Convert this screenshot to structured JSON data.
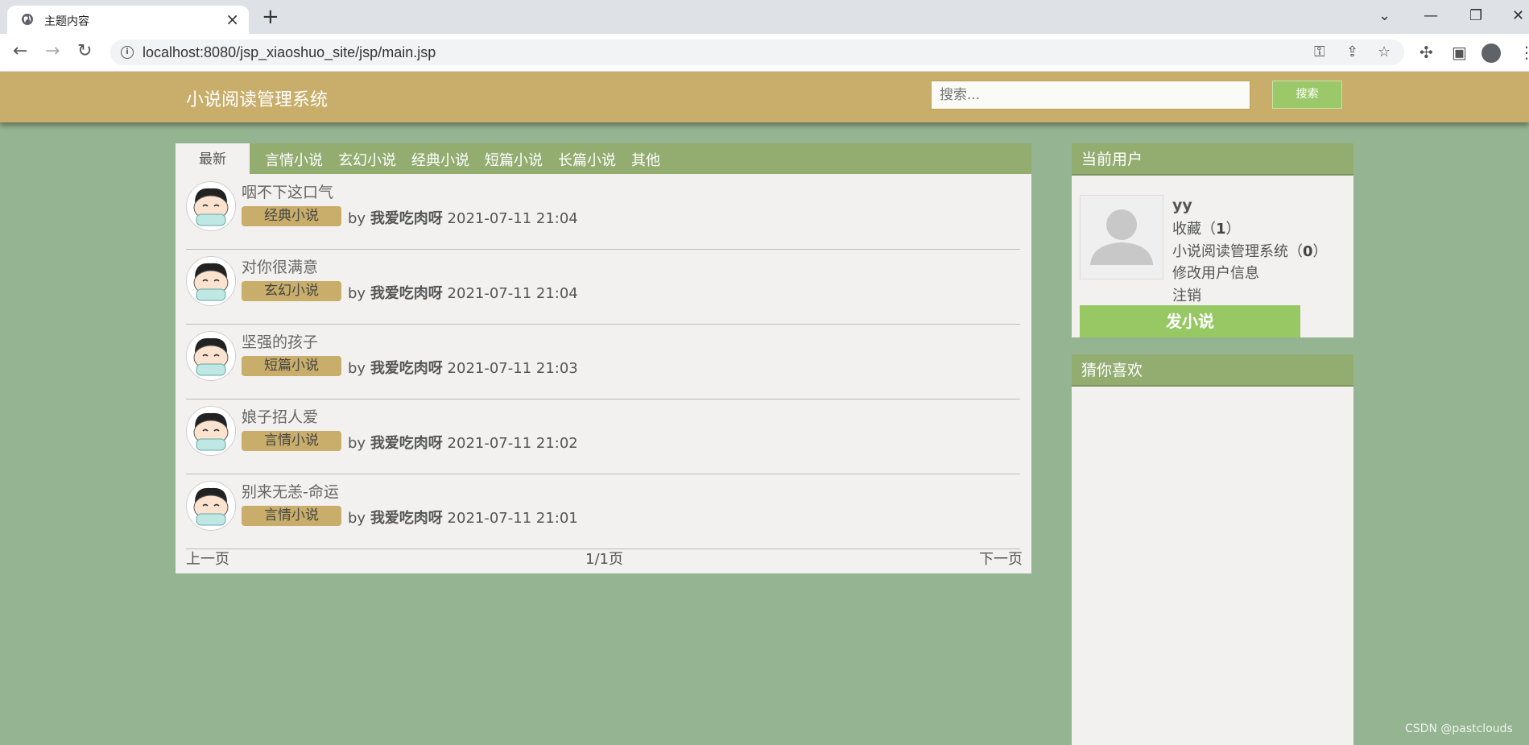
{
  "browser": {
    "tab_title": "主题内容",
    "url": "localhost:8080/jsp_xiaoshuo_site/jsp/main.jsp"
  },
  "header": {
    "brand": "小说阅读管理系统",
    "search_placeholder": "搜索...",
    "search_button": "搜索"
  },
  "tabs": {
    "active": "最新",
    "categories": [
      "言情小说",
      "玄幻小说",
      "经典小说",
      "短篇小说",
      "长篇小说",
      "其他"
    ]
  },
  "posts": [
    {
      "title": "咽不下这口气",
      "category": "经典小说",
      "by": "by",
      "author": "我爱吃肉呀",
      "time": "2021-07-11 21:04"
    },
    {
      "title": "对你很满意",
      "category": "玄幻小说",
      "by": "by",
      "author": "我爱吃肉呀",
      "time": "2021-07-11 21:04"
    },
    {
      "title": "坚强的孩子",
      "category": "短篇小说",
      "by": "by",
      "author": "我爱吃肉呀",
      "time": "2021-07-11 21:03"
    },
    {
      "title": "娘子招人爱",
      "category": "言情小说",
      "by": "by",
      "author": "我爱吃肉呀",
      "time": "2021-07-11 21:02"
    },
    {
      "title": "别来无恙-命运",
      "category": "言情小说",
      "by": "by",
      "author": "我爱吃肉呀",
      "time": "2021-07-11 21:01"
    }
  ],
  "pager": {
    "prev": "上一页",
    "page": "1/1页",
    "next": "下一页"
  },
  "sidebar": {
    "user_header": "当前用户",
    "username": "yy",
    "favorites_label": "收藏（",
    "favorites_count": "1",
    "site_label": "小说阅读管理系统（",
    "site_count": "0",
    "close_paren": "）",
    "edit_info": "修改用户信息",
    "logout": "注销",
    "post_button": "发小说",
    "recommend_header": "猜你喜欢"
  },
  "watermark": "CSDN @pastclouds"
}
